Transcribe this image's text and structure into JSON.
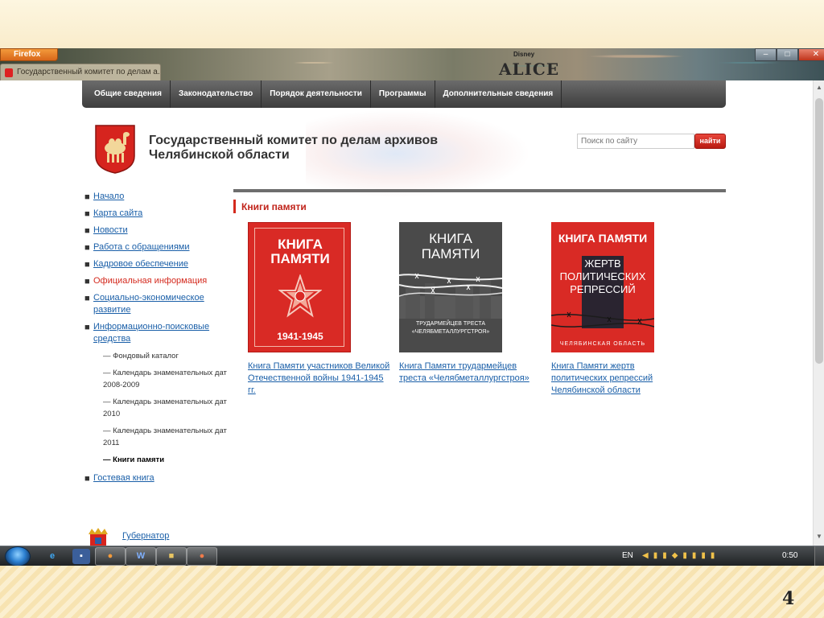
{
  "slide": {
    "page_number": "4"
  },
  "browser": {
    "menu_button": "Firefox",
    "tab_title": "Государственный комитет по делам а...",
    "theme_logo_top": "Disney",
    "theme_logo": "ALICE",
    "window_buttons": {
      "minimize": "–",
      "maximize": "□",
      "close": "✕"
    }
  },
  "site": {
    "nav": [
      "Общие сведения",
      "Законодательство",
      "Порядок деятельности",
      "Программы",
      "Дополнительные сведения"
    ],
    "title_line1": "Государственный комитет по делам архивов",
    "title_line2": "Челябинской области",
    "search": {
      "placeholder": "Поиск по сайту",
      "button": "найти"
    },
    "sidebar": [
      {
        "label": "Начало"
      },
      {
        "label": "Карта сайта"
      },
      {
        "label": "Новости"
      },
      {
        "label": "Работа с обращениями"
      },
      {
        "label": "Кадровое обеспечение"
      },
      {
        "label": "Официальная информация"
      },
      {
        "label": "Социально-экономическое развитие"
      },
      {
        "label": "Информационно-поисковые средства"
      }
    ],
    "sub_items": [
      "— Фондовый каталог",
      "— Календарь знаменательных дат 2008-2009",
      "— Календарь знаменательных дат 2010",
      "— Календарь знаменательных дат 2011",
      "— Книги памяти"
    ],
    "guestbook": "Гостевая книга",
    "section_title": "Книги памяти",
    "books": [
      {
        "cover_line1": "КНИГА",
        "cover_line2": "ПАМЯТИ",
        "cover_years": "1941-1945",
        "caption": "Книга Памяти участников Великой Отечественной войны 1941-1945 гг."
      },
      {
        "cover_line1": "КНИГА",
        "cover_line2": "ПАМЯТИ",
        "cover_sub1": "ТРУДАРМЕЙЦЕВ ТРЕСТА",
        "cover_sub2": "«ЧЕЛЯБМЕТАЛЛУРГСТРОЯ»",
        "caption": "Книга Памяти трудармейцев треста «Челябметаллургстроя»"
      },
      {
        "cover_line1": "КНИГА ПАМЯТИ",
        "cover_l1": "ЖЕРТВ",
        "cover_l2": "ПОЛИТИЧЕСКИХ",
        "cover_l3": "РЕПРЕССИЙ",
        "cover_region": "ЧЕЛЯБИНСКАЯ ОБЛАСТЬ",
        "caption": "Книга Памяти жертв политических репрессий Челябинской области"
      }
    ],
    "governor_link": "Губернатор"
  },
  "taskbar": {
    "language": "EN",
    "time": "0:50"
  }
}
